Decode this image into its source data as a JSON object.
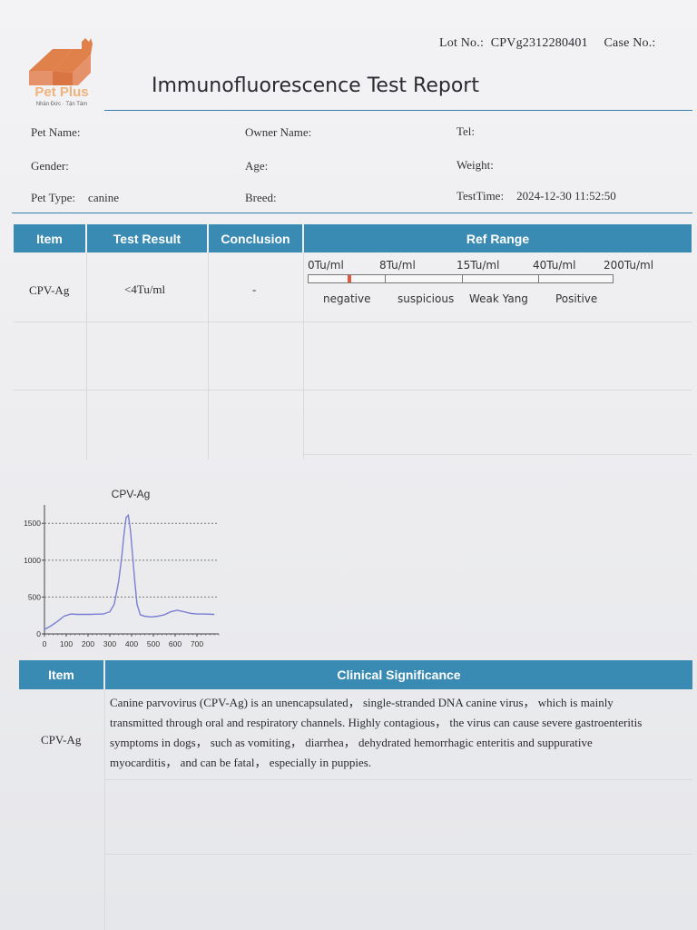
{
  "header": {
    "logo_text": "Pet Plus",
    "logo_tagline": "Nhân Đức · Tận Tâm",
    "lot_label": "Lot No.:",
    "lot_value": "CPVg2312280401",
    "case_label": "Case No.:",
    "title": "Immunofluorescence Test Report"
  },
  "info": {
    "pet_name_label": "Pet Name:",
    "owner_name_label": "Owner Name:",
    "tel_label": "Tel:",
    "gender_label": "Gender:",
    "age_label": "Age:",
    "weight_label": "Weight:",
    "pet_type_label": "Pet Type:",
    "pet_type_value": "canine",
    "breed_label": "Breed:",
    "test_time_label": "TestTime:",
    "test_time_value": "2024-12-30 11:52:50"
  },
  "result_table": {
    "headers": [
      "Item",
      "Test Result",
      "Conclusion",
      "Ref Range"
    ],
    "rows": [
      {
        "item": "CPV-Ag",
        "result": "<4Tu/ml",
        "conclusion": "-"
      }
    ],
    "ref_range": {
      "thresholds": [
        "0Tu/ml",
        "8Tu/ml",
        "15Tu/ml",
        "40Tu/ml",
        "200Tu/ml"
      ],
      "categories": [
        "negative",
        "suspicious",
        "Weak Yang",
        "Positive"
      ],
      "marker_color": "#e05a3e"
    }
  },
  "chart_data": {
    "type": "line",
    "title": "CPV-Ag",
    "xlabel": "",
    "ylabel": "",
    "xlim": [
      0,
      800
    ],
    "ylim": [
      0,
      1700
    ],
    "x_ticks": [
      0,
      100,
      200,
      300,
      400,
      500,
      600,
      700
    ],
    "y_ticks": [
      0,
      500,
      1000,
      1500
    ],
    "reference_lines": [
      500,
      1000,
      1500
    ],
    "grid": false,
    "series": [
      {
        "color": "#7b7fd4",
        "x": [
          0,
          30,
          60,
          90,
          120,
          150,
          180,
          210,
          240,
          270,
          300,
          320,
          340,
          355,
          365,
          375,
          385,
          395,
          405,
          415,
          425,
          440,
          460,
          490,
          520,
          550,
          580,
          610,
          640,
          670,
          700,
          730,
          780
        ],
        "y": [
          60,
          110,
          170,
          240,
          270,
          265,
          265,
          265,
          268,
          270,
          300,
          400,
          700,
          1050,
          1350,
          1580,
          1610,
          1400,
          1050,
          700,
          400,
          260,
          240,
          230,
          240,
          260,
          300,
          320,
          300,
          280,
          270,
          270,
          265
        ]
      }
    ]
  },
  "clinical_table": {
    "headers": [
      "Item",
      "Clinical Significance"
    ],
    "item": "CPV-Ag",
    "lines": [
      "Canine parvovirus (CPV-Ag) is an unencapsulated， single-stranded DNA canine virus， which is mainly",
      "transmitted through oral and respiratory channels. Highly contagious， the virus can cause severe gastroenteritis",
      "symptoms in dogs， such as vomiting， diarrhea， dehydrated hemorrhagic enteritis and suppurative",
      "myocarditis， and can be fatal， especially in puppies."
    ]
  },
  "colors": {
    "header_blue": "#3a8bb4",
    "logo_orange": "#e0804a"
  }
}
